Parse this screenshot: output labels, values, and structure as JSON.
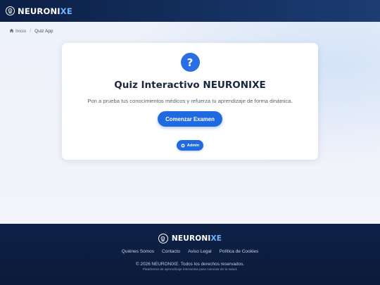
{
  "brand": {
    "name_main": "NEURONI",
    "name_accent": "XE",
    "logo_icon": "neuron-icon",
    "accent_color": "#6fb6ff"
  },
  "breadcrumb": {
    "home_icon": "home-icon",
    "home": "Inicio",
    "separator": "/",
    "current": "Quiz App"
  },
  "card": {
    "icon": "question-mark-icon",
    "icon_glyph": "?",
    "title": "Quiz Interactivo NEURONIXE",
    "subtitle": "Pon a prueba tus conocimientos médicos y refuerza tu aprendizaje de forma dinámica.",
    "start_button": "Comenzar Examen",
    "admin_button": "Admin",
    "admin_icon": "gear-icon",
    "primary_color": "#1f6ae0"
  },
  "footer": {
    "brand_main": "NEURONI",
    "brand_accent": "XE",
    "links": [
      "Quiénes Somos",
      "Contacto",
      "Aviso Legal",
      "Política de Cookies"
    ],
    "copyright": "© 2026 NEURONIXE. Todos los derechos reservados.",
    "tagline": "Plataforma de aprendizaje interactiva para ciencias de la salud."
  }
}
